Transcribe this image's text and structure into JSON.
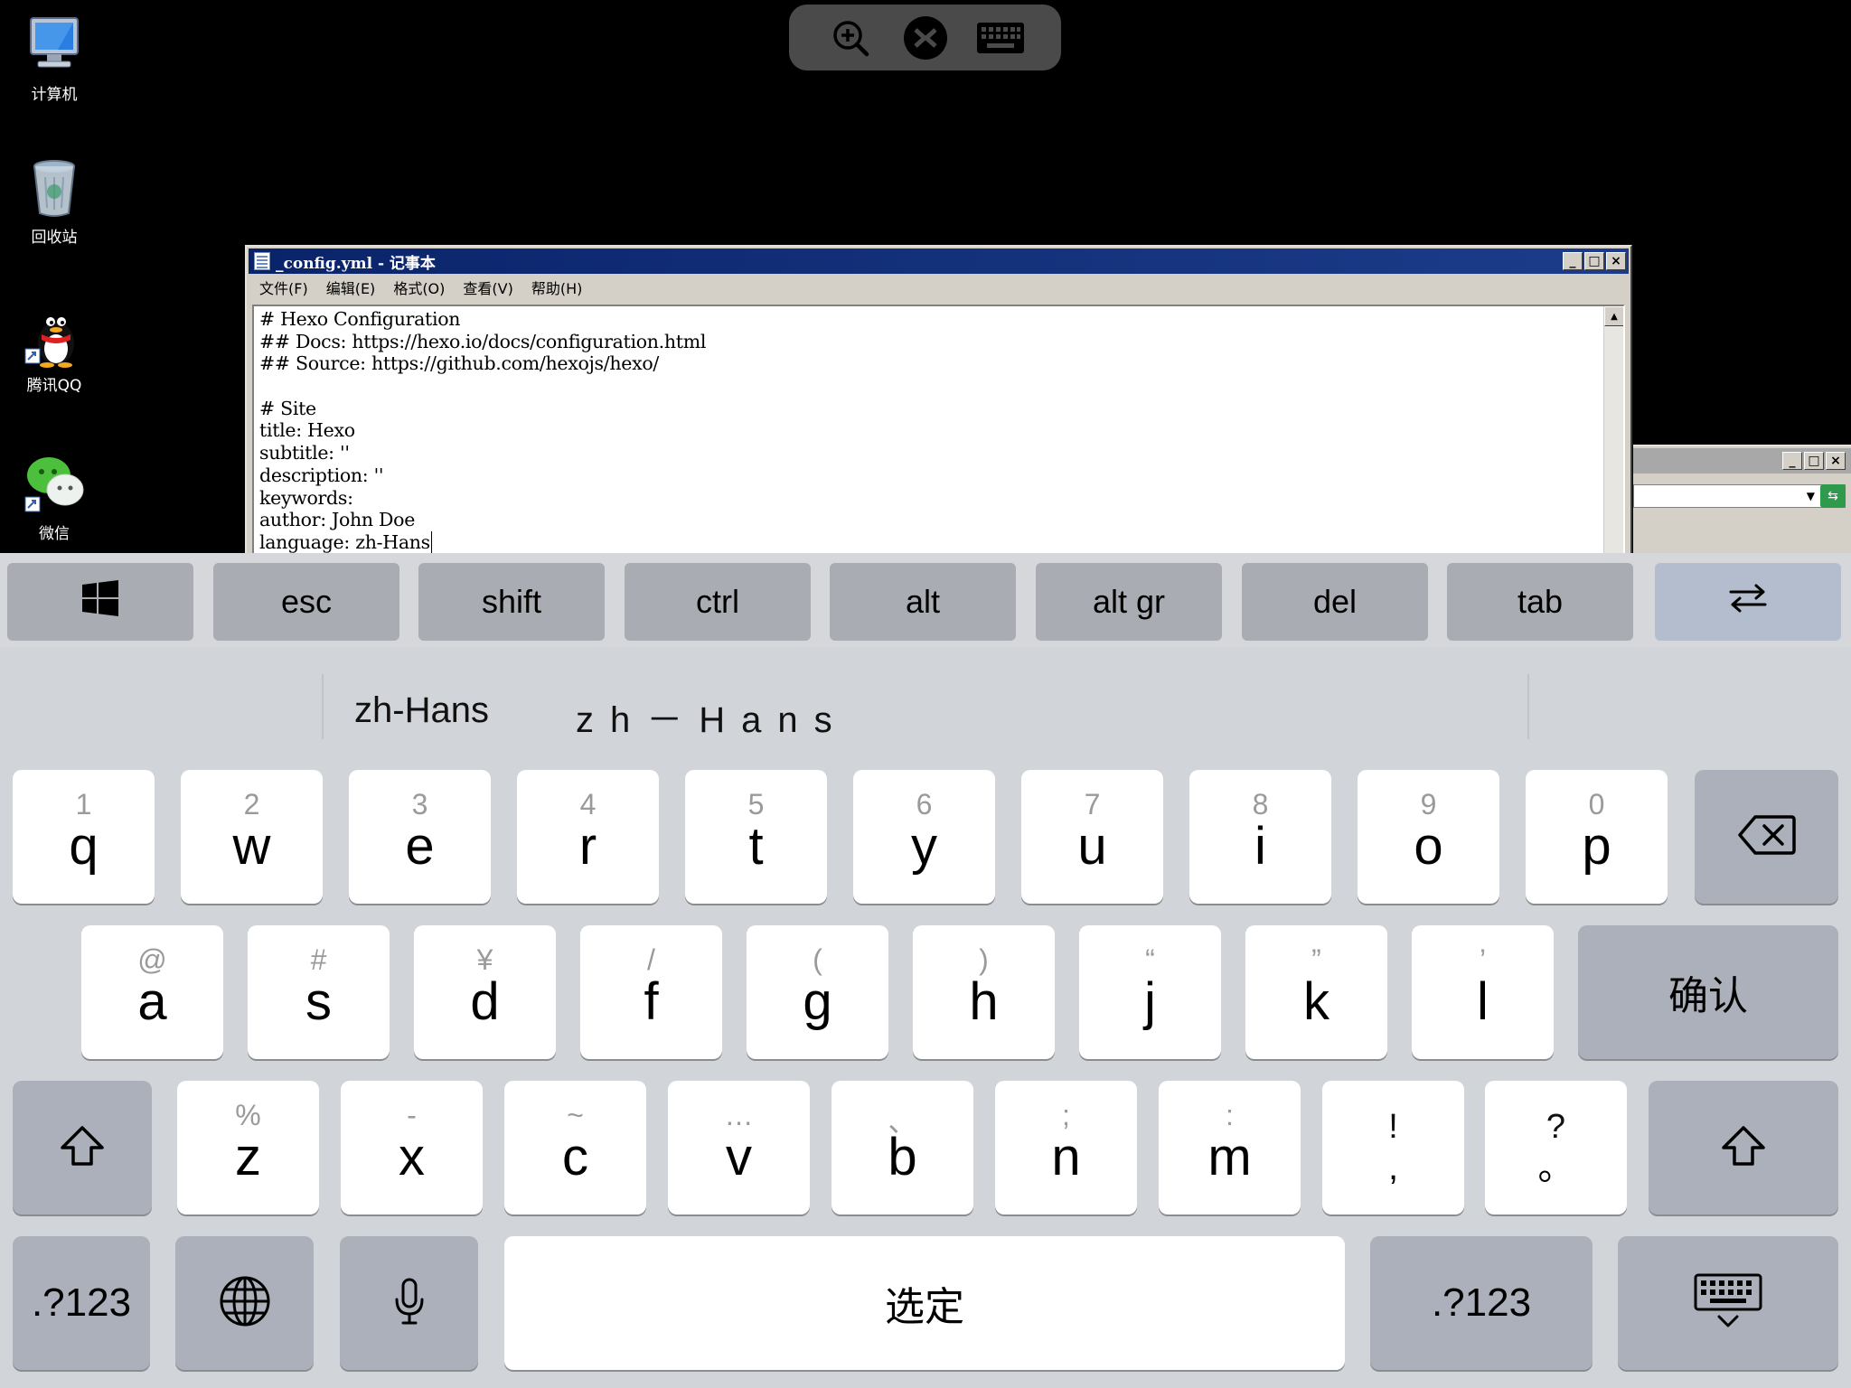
{
  "desktop": {
    "icons": [
      {
        "label": "计算机",
        "icon": "computer-icon"
      },
      {
        "label": "回收站",
        "icon": "recycle-bin-icon"
      },
      {
        "label": "腾讯QQ",
        "icon": "qq-penguin-icon"
      },
      {
        "label": "微信",
        "icon": "wechat-icon"
      }
    ]
  },
  "remote_toolbar": {
    "buttons": [
      "zoom-in-icon",
      "remote-desktop-icon",
      "keyboard-icon"
    ]
  },
  "notepad": {
    "title": "_config.yml - 记事本",
    "menu": [
      "文件(F)",
      "编辑(E)",
      "格式(O)",
      "查看(V)",
      "帮助(H)"
    ],
    "lines": [
      "# Hexo Configuration",
      "## Docs: https://hexo.io/docs/configuration.html",
      "## Source: https://github.com/hexojs/hexo/",
      "",
      "# Site",
      "title: Hexo",
      "subtitle: ''",
      "description: ''",
      "keywords:",
      "author: John Doe",
      "language: zh-Hans"
    ],
    "window_buttons": [
      "_",
      "□",
      "×"
    ]
  },
  "window2": {
    "window_buttons": [
      "_",
      "□",
      "×"
    ]
  },
  "keyboard": {
    "ext_keys": [
      "esc",
      "shift",
      "ctrl",
      "alt",
      "alt gr",
      "del",
      "tab"
    ],
    "ext_icons": [
      "windows-icon",
      "swap-arrows-icon"
    ],
    "candidates": [
      "zh-Hans",
      "zh－Hans"
    ],
    "row1": [
      {
        "sec": "1",
        "pri": "q"
      },
      {
        "sec": "2",
        "pri": "w"
      },
      {
        "sec": "3",
        "pri": "e"
      },
      {
        "sec": "4",
        "pri": "r"
      },
      {
        "sec": "5",
        "pri": "t"
      },
      {
        "sec": "6",
        "pri": "y"
      },
      {
        "sec": "7",
        "pri": "u"
      },
      {
        "sec": "8",
        "pri": "i"
      },
      {
        "sec": "9",
        "pri": "o"
      },
      {
        "sec": "0",
        "pri": "p"
      }
    ],
    "row2": [
      {
        "sec": "@",
        "pri": "a"
      },
      {
        "sec": "#",
        "pri": "s"
      },
      {
        "sec": "¥",
        "pri": "d"
      },
      {
        "sec": "/",
        "pri": "f"
      },
      {
        "sec": "(",
        "pri": "g"
      },
      {
        "sec": ")",
        "pri": "h"
      },
      {
        "sec": "“",
        "pri": "j"
      },
      {
        "sec": "”",
        "pri": "k"
      },
      {
        "sec": "’",
        "pri": "l"
      }
    ],
    "confirm_label": "确认",
    "row3": [
      {
        "sec": "%",
        "pri": "z"
      },
      {
        "sec": "-",
        "pri": "x"
      },
      {
        "sec": "~",
        "pri": "c"
      },
      {
        "sec": "…",
        "pri": "v"
      },
      {
        "sec": "、",
        "pri": "b"
      },
      {
        "sec": ";",
        "pri": "n"
      },
      {
        "sec": ":",
        "pri": "m"
      }
    ],
    "punct_keys": [
      {
        "sec": "!",
        "pri": ","
      },
      {
        "sec": "?",
        "pri": "。"
      }
    ],
    "num_label": ".?123",
    "space_label": "选定"
  }
}
